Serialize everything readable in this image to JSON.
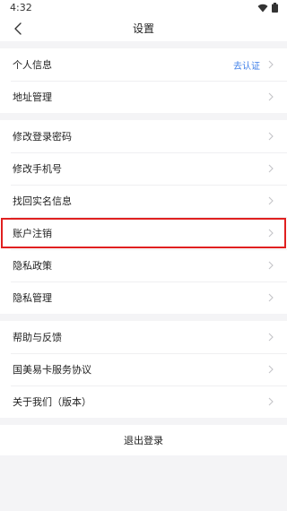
{
  "status_bar": {
    "time": "4:32"
  },
  "header": {
    "title": "设置"
  },
  "groups": [
    {
      "items": [
        {
          "label": "个人信息",
          "value": "去认证"
        },
        {
          "label": "地址管理"
        }
      ]
    },
    {
      "items": [
        {
          "label": "修改登录密码"
        },
        {
          "label": "修改手机号"
        },
        {
          "label": "找回实名信息"
        },
        {
          "label": "账户注销",
          "highlighted": true
        },
        {
          "label": "隐私政策"
        },
        {
          "label": "隐私管理"
        }
      ]
    },
    {
      "items": [
        {
          "label": "帮助与反馈"
        },
        {
          "label": "国美易卡服务协议"
        },
        {
          "label": "关于我们（版本）"
        }
      ]
    }
  ],
  "logout": {
    "label": "退出登录"
  },
  "colors": {
    "accent": "#3d7ee8",
    "highlight_border": "#e02020",
    "background": "#f4f4f6"
  }
}
